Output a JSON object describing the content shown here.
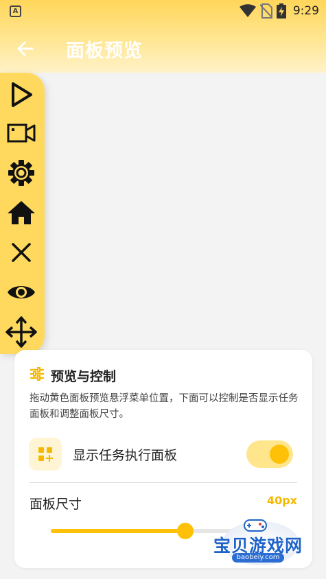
{
  "status_bar": {
    "time": "9:29",
    "left_badge": "A",
    "icons": [
      "wifi-icon",
      "no-sim-icon",
      "battery-charging-icon"
    ]
  },
  "header": {
    "title": "面板预览",
    "back_icon": "arrow-left-icon"
  },
  "floating_panel": {
    "color": "#ffd95e",
    "icons": [
      "play-icon",
      "video-camera-icon",
      "gear-icon",
      "home-icon",
      "close-icon",
      "eye-icon",
      "move-icon"
    ]
  },
  "control_card": {
    "title": "预览与控制",
    "description": "拖动黄色面板预览悬浮菜单位置，下面可以控制是否显示任务面板和调整面板尺寸。",
    "show_task_panel": {
      "label": "显示任务执行面板",
      "enabled": true
    },
    "panel_size": {
      "label": "面板尺寸",
      "value": "40px",
      "slider_fraction": 0.595
    }
  },
  "watermark": {
    "text": "宝贝游戏网",
    "site": "baobeiy.com"
  },
  "colors": {
    "accent": "#ffc107",
    "header_top": "#ffd65a",
    "value_text": "#f5b800"
  }
}
